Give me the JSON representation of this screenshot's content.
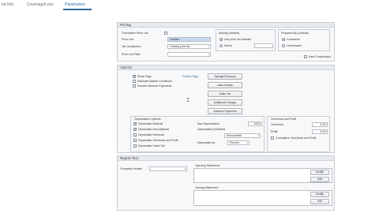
{
  "tabs": [
    "ed Info",
    "Coverage/Loss",
    "Parameters"
  ],
  "pricing": {
    "title": "Pricing",
    "override_label": "Overridden Price List",
    "price_list_label": "Price List",
    "price_list_value": "Yandere",
    "tax_label": "Tax Jurisdiction",
    "tax_value": "Training price list",
    "filter_label": "Price List Filter",
    "activity_title": "Activity (Default)",
    "activity_opt1": "Use price list defaults",
    "activity_opt2": "Select",
    "prepared_title": "Prepared By (Default)",
    "prepared_opt1": "Contractor",
    "prepared_opt2": "Homeowner",
    "new_construction": "New Construction"
  },
  "addon": {
    "title": "Add On",
    "show_tags": "Show Tags",
    "estimate_market": "Estimate Market Conditions",
    "include_advance": "Include Advance Payments",
    "default_tags": "Default Tags",
    "buttons": [
      "Salvage Recovery",
      "Labor Burden",
      "Sales Tax",
      "Additional Charges",
      "Advance Payments"
    ],
    "depr_title": "Depreciation Options",
    "depr_items": [
      "Depreciate Material",
      "Depreciate Non-Material",
      "Depreciate Removal",
      "Depreciate Overhead and Profit",
      "Depreciate Sales Tax"
    ],
    "max_depr_label": "Max Depreciation",
    "max_depr_value": "100%",
    "depr_default_label": "Depreciation (Default)",
    "depr_default_value": "Recoverable",
    "depr_as_label": "Depreciate As",
    "depr_as_value": "Percent",
    "op_title": "Overhead and Profit",
    "overhead_label": "Overhead",
    "overhead_value": "0.0%",
    "profit_label": "Profit",
    "profit_value": "0.0%",
    "cumulative": "Cumulative Overhead and Profit"
  },
  "report": {
    "title": "Report Text",
    "company_header_label": "Company Header",
    "opening_label": "Opening Statement",
    "closing_label": "Closing Statement",
    "modify": "Modify",
    "edit": "Edit"
  }
}
